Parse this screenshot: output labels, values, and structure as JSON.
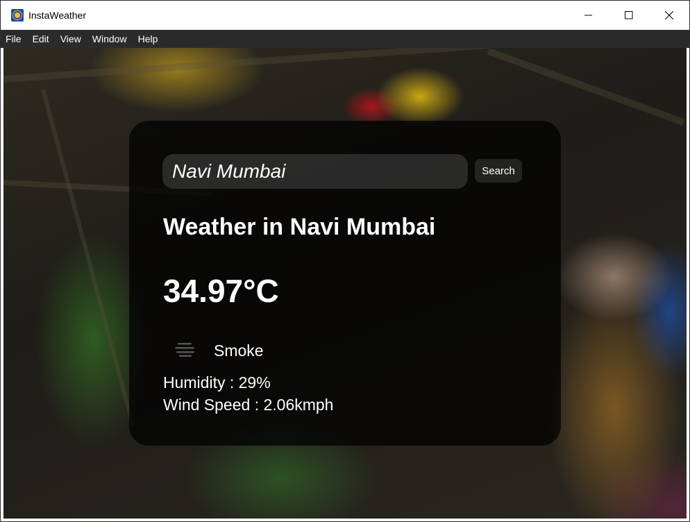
{
  "window": {
    "title": "InstaWeather",
    "controls": [
      "minimize",
      "maximize",
      "close"
    ]
  },
  "menubar": {
    "items": [
      "File",
      "Edit",
      "View",
      "Window",
      "Help"
    ]
  },
  "search": {
    "value": "Navi Mumbai",
    "button_label": "Search"
  },
  "weather": {
    "title": "Weather in Navi Mumbai",
    "temperature": "34.97°C",
    "condition": "Smoke",
    "condition_icon": "smoke-icon",
    "humidity": "Humidity : 29%",
    "wind_speed": "Wind Speed : 2.06kmph"
  },
  "colors": {
    "menubar_bg": "#2b2b2b",
    "card_bg": "rgba(0,0,0,0.72)",
    "text": "#ffffff",
    "app_icon": "#1d4aa8"
  }
}
